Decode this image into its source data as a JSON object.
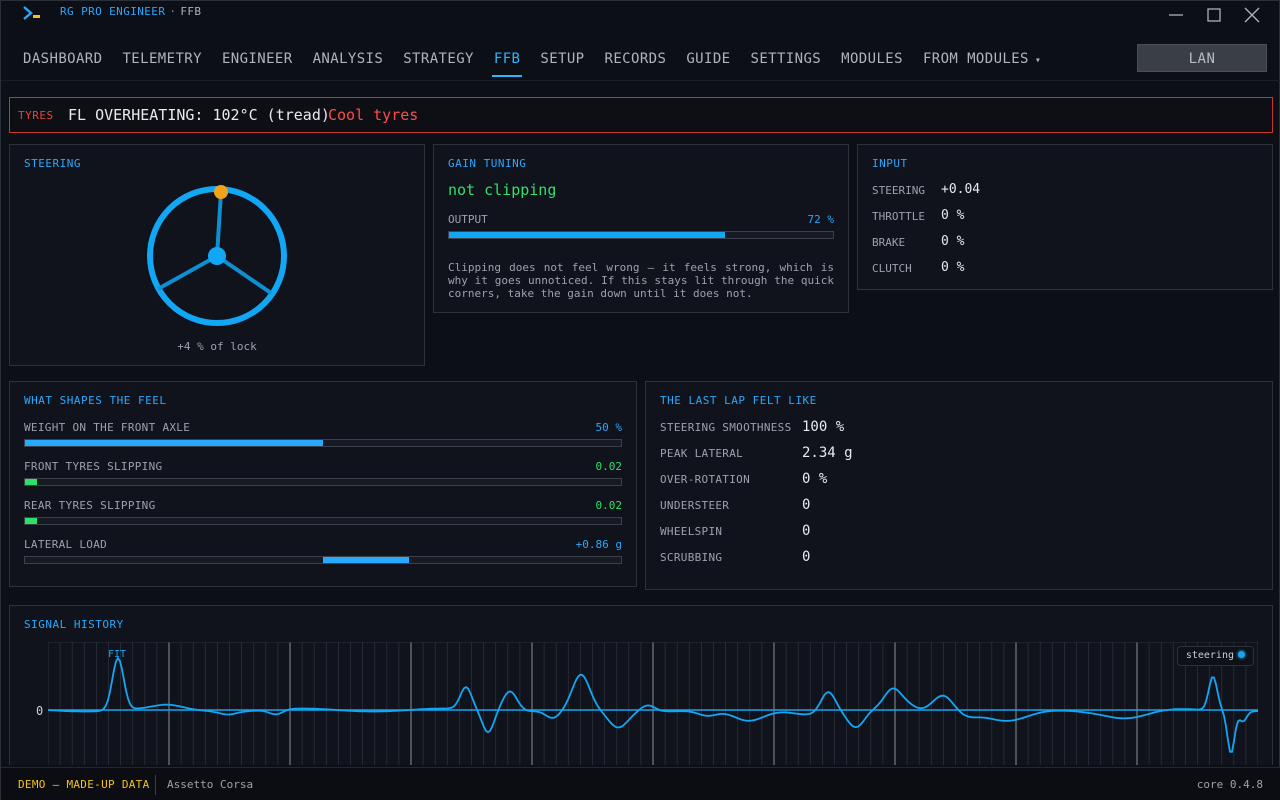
{
  "app": {
    "title": "RG PRO ENGINEER",
    "separator": "·",
    "page": "FFB"
  },
  "nav": {
    "items": [
      "DASHBOARD",
      "TELEMETRY",
      "ENGINEER",
      "ANALYSIS",
      "STRATEGY",
      "FFB",
      "SETUP",
      "RECORDS",
      "GUIDE",
      "SETTINGS",
      "MODULES",
      "FROM MODULES"
    ],
    "active": "FFB",
    "dropdown_caret": "▾",
    "lan_label": "LAN"
  },
  "alert": {
    "tag": "TYRES",
    "message": "FL OVERHEATING: 102°C (tread)",
    "action": "Cool tyres",
    "color": "#e0453a"
  },
  "steering": {
    "title": "STEERING",
    "lock_label": "+4 % of lock",
    "lock_percent": 4
  },
  "gain": {
    "title": "GAIN TUNING",
    "status": "not clipping",
    "output_label": "OUTPUT",
    "output_value": "72 %",
    "output_fraction": 0.72,
    "note": "Clipping does not feel wrong — it feels strong, which is why it goes unnoticed. If this stays lit through the quick corners, take the gain down until it does not."
  },
  "input": {
    "title": "INPUT",
    "rows": [
      {
        "label": "STEERING",
        "value": "+0.04"
      },
      {
        "label": "THROTTLE",
        "value": "0 %"
      },
      {
        "label": "BRAKE",
        "value": "0 %"
      },
      {
        "label": "CLUTCH",
        "value": "0 %"
      }
    ]
  },
  "feel": {
    "title": "WHAT SHAPES THE FEEL",
    "rows": [
      {
        "label": "WEIGHT ON THE FRONT AXLE",
        "value": "50 %",
        "fraction": 0.5,
        "color": "#29a8ff",
        "mode": "left"
      },
      {
        "label": "FRONT TYRES SLIPPING",
        "value": "0.02",
        "fraction": 0.02,
        "color": "#2ee06a",
        "mode": "left"
      },
      {
        "label": "REAR TYRES SLIPPING",
        "value": "0.02",
        "fraction": 0.02,
        "color": "#2ee06a",
        "mode": "left"
      },
      {
        "label": "LATERAL LOAD",
        "value": "+0.86 g",
        "fraction": 0.144,
        "color": "#29a8ff",
        "mode": "center"
      }
    ]
  },
  "lap": {
    "title": "THE LAST LAP FELT LIKE",
    "rows": [
      {
        "label": "STEERING SMOOTHNESS",
        "value": "100 %"
      },
      {
        "label": "PEAK LATERAL",
        "value": "2.34 g"
      },
      {
        "label": "OVER-ROTATION",
        "value": "0 %"
      },
      {
        "label": "UNDERSTEER",
        "value": "0"
      },
      {
        "label": "WHEELSPIN",
        "value": "0"
      },
      {
        "label": "SCRUBBING",
        "value": "0"
      }
    ]
  },
  "signal": {
    "title": "SIGNAL HISTORY",
    "zero_label": "0",
    "annotation": "FIT",
    "legend": "steering",
    "line_color": "#11a7f5"
  },
  "status": {
    "demo": "DEMO — MADE-UP DATA",
    "game": "Assetto Corsa",
    "version": "core 0.4.8"
  }
}
